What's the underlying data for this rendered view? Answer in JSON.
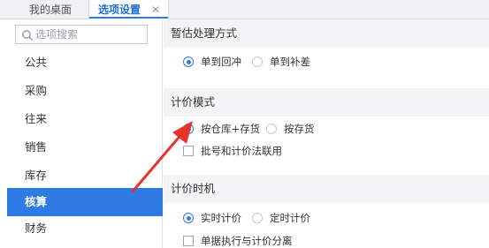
{
  "tabs": {
    "home_label": "我的桌面",
    "active_label": "选项设置",
    "close_symbol": "✕"
  },
  "sidebar": {
    "search_placeholder": "选项搜索",
    "items": [
      {
        "label": "公共"
      },
      {
        "label": "采购"
      },
      {
        "label": "往来"
      },
      {
        "label": "销售"
      },
      {
        "label": "库存"
      },
      {
        "label": "核算",
        "active": true
      },
      {
        "label": "财务"
      }
    ]
  },
  "sections": {
    "estimate": {
      "title": "暂估处理方式",
      "options": [
        {
          "label": "单到回冲",
          "checked": true
        },
        {
          "label": "单到补差",
          "checked": false
        }
      ]
    },
    "pricing_mode": {
      "title": "计价模式",
      "options": [
        {
          "label": "按仓库+存货",
          "checked": true
        },
        {
          "label": "按存货",
          "checked": false
        }
      ],
      "checkbox_label": "批号和计价法联用"
    },
    "pricing_timing": {
      "title": "计价时机",
      "options": [
        {
          "label": "实时计价",
          "checked": true
        },
        {
          "label": "定时计价",
          "checked": false
        }
      ],
      "checkbox_label": "单据执行与计价分离"
    }
  },
  "colors": {
    "accent": "#2f7be5",
    "arrow": "#e8322c"
  },
  "icons": [
    "search-icon",
    "close-icon",
    "annotation-arrow"
  ]
}
